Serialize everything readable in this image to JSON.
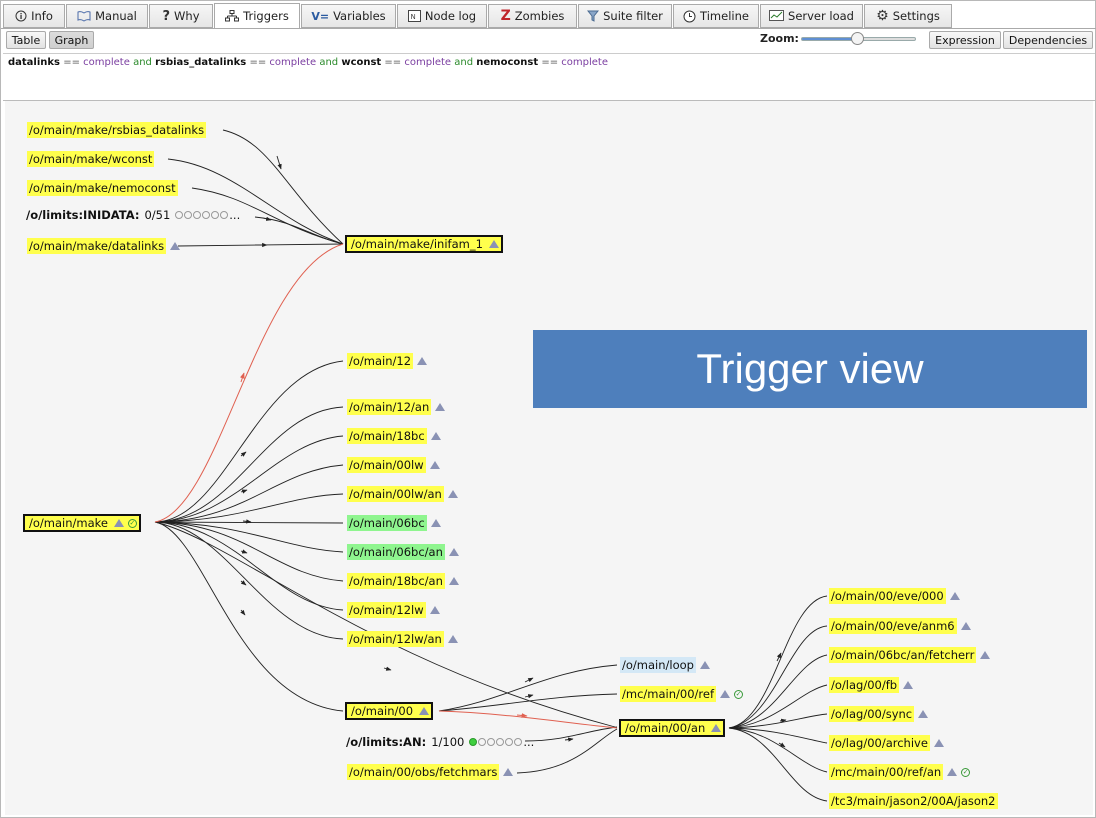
{
  "tabs": [
    {
      "label": "Info",
      "icon": "info-icon"
    },
    {
      "label": "Manual",
      "icon": "manual-icon"
    },
    {
      "label": "Why",
      "icon": "question-icon"
    },
    {
      "label": "Triggers",
      "icon": "triggers-icon"
    },
    {
      "label": "Variables",
      "icon": "variables-icon"
    },
    {
      "label": "Node log",
      "icon": "node-log-icon"
    },
    {
      "label": "Zombies",
      "icon": "zombies-icon"
    },
    {
      "label": "Suite filter",
      "icon": "filter-icon"
    },
    {
      "label": "Timeline",
      "icon": "clock-icon"
    },
    {
      "label": "Server load",
      "icon": "server-load-icon"
    },
    {
      "label": "Settings",
      "icon": "gear-icon"
    }
  ],
  "active_tab": "Triggers",
  "toolbar": {
    "table_label": "Table",
    "graph_label": "Graph",
    "zoom_label": "Zoom:",
    "zoom_level": 0.5,
    "expression_label": "Expression",
    "dependencies_label": "Dependencies"
  },
  "expression": {
    "t1": "datalinks",
    "op1": "==",
    "v1": "complete",
    "and1": "and",
    "t2": "rsbias_datalinks",
    "op2": "==",
    "v2": "complete",
    "and2": "and",
    "t3": "wconst",
    "op3": "==",
    "v3": "complete",
    "and3": "and",
    "t4": "nemoconst",
    "op4": "==",
    "v4": "complete"
  },
  "nodes": {
    "rsbias": "/o/main/make/rsbias_datalinks",
    "wconst": "/o/main/make/wconst",
    "nemoconst": "/o/main/make/nemoconst",
    "datalinks": "/o/main/make/datalinks",
    "inifam": "/o/main/make/inifam_1",
    "make": "/o/main/make",
    "n12": "/o/main/12",
    "n12an": "/o/main/12/an",
    "n18bc": "/o/main/18bc",
    "n00lw": "/o/main/00lw",
    "n00lwan": "/o/main/00lw/an",
    "n06bc": "/o/main/06bc",
    "n06bcan": "/o/main/06bc/an",
    "n18bcan": "/o/main/18bc/an",
    "n12lw": "/o/main/12lw",
    "n12lwan": "/o/main/12lw/an",
    "n00": "/o/main/00",
    "fetchmars": "/o/main/00/obs/fetchmars",
    "loop": "/o/main/loop",
    "mcref": "/mc/main/00/ref",
    "n00an": "/o/main/00/an",
    "eve000": "/o/main/00/eve/000",
    "anm6": "/o/main/00/eve/anm6",
    "fetcherr": "/o/main/06bc/an/fetcherr",
    "fb": "/o/lag/00/fb",
    "sync": "/o/lag/00/sync",
    "archive": "/o/lag/00/archive",
    "mcrefan": "/mc/main/00/ref/an",
    "jason2": "/tc3/main/jason2/00A/jason2"
  },
  "limits": {
    "inidata_name": "/o/limits:INIDATA:",
    "inidata_value": "0/51",
    "inidata_ellipsis": "...",
    "an_name": "/o/limits:AN:",
    "an_value": "1/100",
    "an_ellipsis": "..."
  },
  "callout": "Trigger view",
  "colors": {
    "accent": "#4e7fbc",
    "node_active": "#ffff4d",
    "node_complete": "#8ff58f",
    "node_queued": "#d4e8f6",
    "edge_red": "#e06050"
  }
}
